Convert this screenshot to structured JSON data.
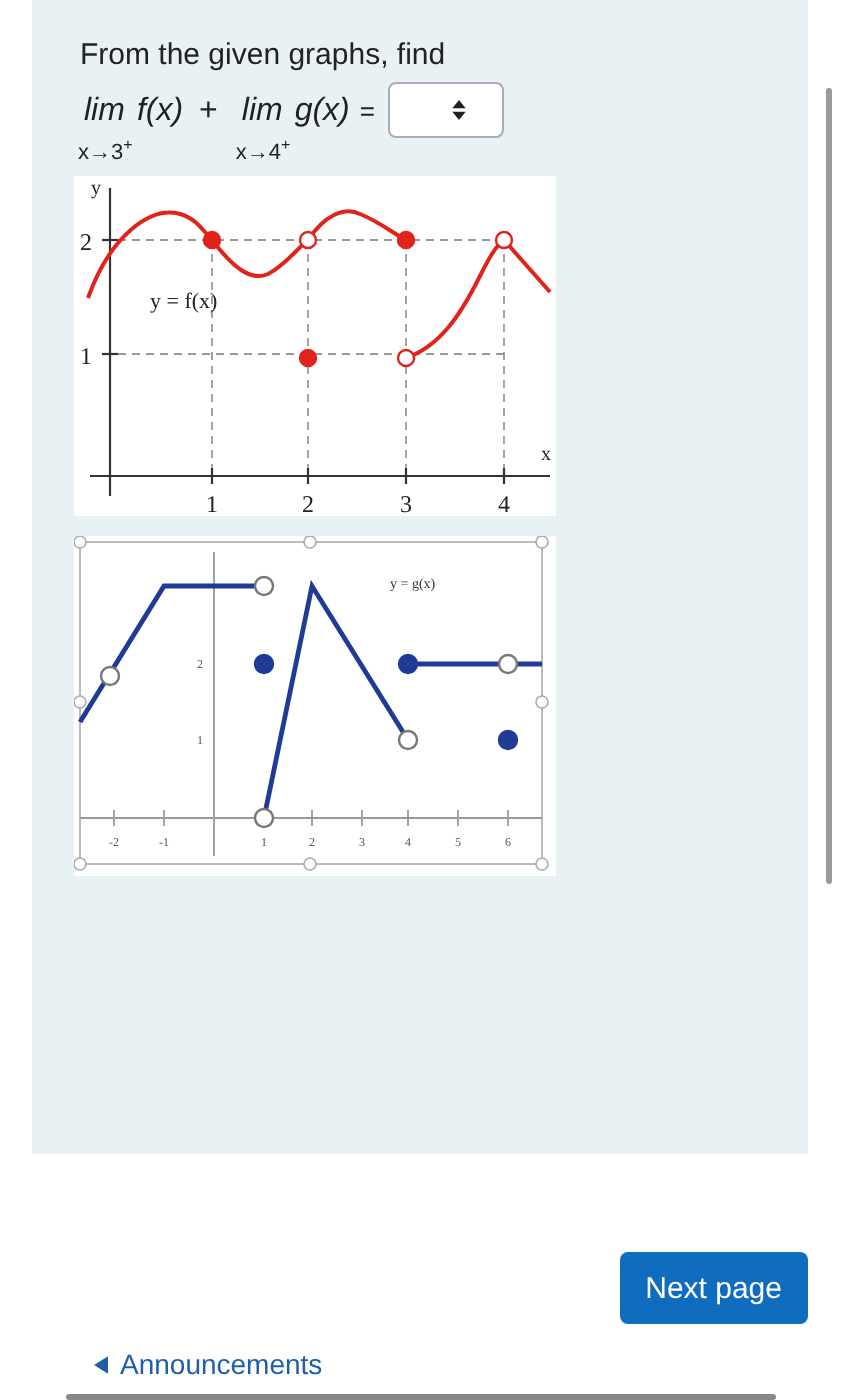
{
  "question": {
    "prompt": "From the given graphs, find",
    "limits": [
      {
        "word": "lim",
        "expr": "f(x)",
        "approach": "x→3$^{+}$"
      },
      {
        "word": "lim",
        "expr": "g(x)",
        "approach": "x→4$^{+}$"
      }
    ],
    "operator": "+",
    "equals": "=",
    "answer": {
      "kind": "select"
    }
  },
  "graphs": [
    {
      "kind": "f",
      "label": "y = f(x)",
      "x_axis": "x",
      "y_axis": "y",
      "x_ticks": [
        "1",
        "2",
        "3",
        "4"
      ],
      "y_ticks": [
        "2",
        "1"
      ]
    },
    {
      "kind": "g",
      "label": "y = g(x)",
      "x_ticks": [
        "-2",
        "-1",
        "1",
        "2",
        "3",
        "4",
        "5",
        "6"
      ],
      "y_ticks": [
        "2",
        "1"
      ]
    }
  ],
  "next_button": "Next page",
  "back_link": "Announcements"
}
